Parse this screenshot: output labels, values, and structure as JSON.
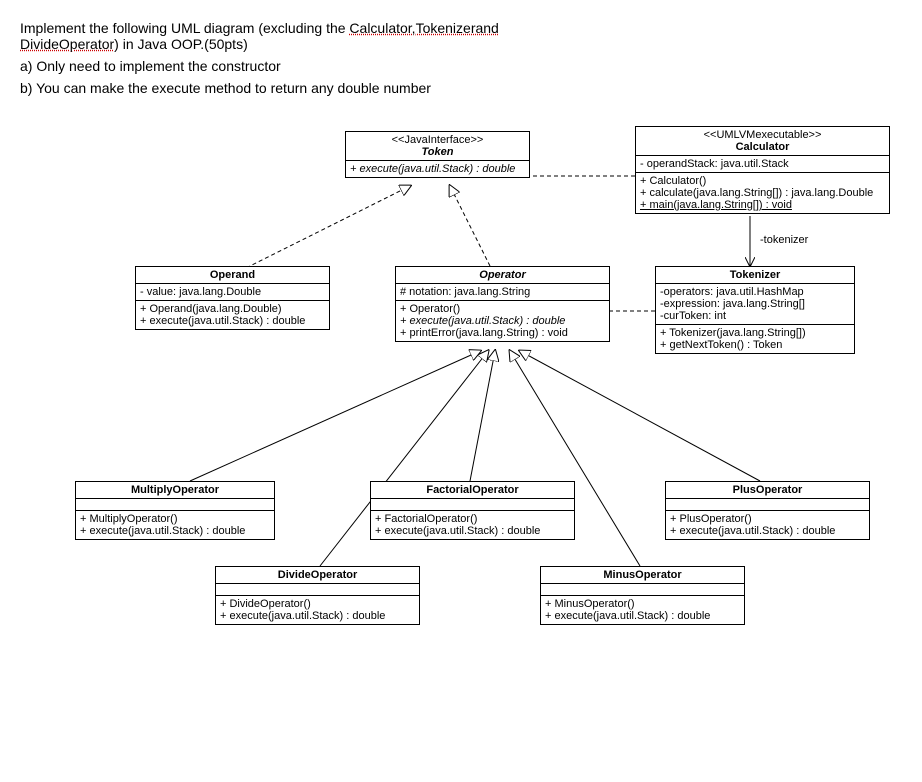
{
  "instructions": {
    "line1a": "Implement the following UML diagram (excluding the ",
    "line1b": "Calculator,Tokenizerand",
    "line2a": "DivideOperator",
    "line2b": ") in Java OOP.(50pts)",
    "lineA": "a) Only need to implement the constructor",
    "lineB": "b) You can make the execute method to return any double number"
  },
  "token": {
    "stereo": "<<JavaInterface>>",
    "name": "Token",
    "methods": "+ execute(java.util.Stack) : double"
  },
  "calculator": {
    "stereo": "<<UMLVMexecutable>>",
    "name": "Calculator",
    "attrs": "- operandStack: java.util.Stack",
    "m1": "+ Calculator()",
    "m2": "+ calculate(java.lang.String[]) : java.lang.Double",
    "m3": "+ main(java.lang.String[]) : void"
  },
  "operand": {
    "name": "Operand",
    "attrs": "- value: java.lang.Double",
    "m1": "+ Operand(java.lang.Double)",
    "m2": "+ execute(java.util.Stack) : double"
  },
  "operator": {
    "name": "Operator",
    "attrs": "# notation: java.lang.String",
    "m1": "+ Operator()",
    "m2": "+ execute(java.util.Stack) : double",
    "m3": "+ printError(java.lang.String) : void"
  },
  "tokenizer": {
    "name": "Tokenizer",
    "a1": "-operators: java.util.HashMap",
    "a2": "-expression: java.lang.String[]",
    "a3": "-curToken: int",
    "m1": "+ Tokenizer(java.lang.String[])",
    "m2": "+ getNextToken() : Token",
    "assoc": "-tokenizer"
  },
  "multiply": {
    "name": "MultiplyOperator",
    "m1": "+ MultiplyOperator()",
    "m2": "+ execute(java.util.Stack) : double"
  },
  "factorial": {
    "name": "FactorialOperator",
    "m1": "+ FactorialOperator()",
    "m2": "+ execute(java.util.Stack) : double"
  },
  "plus": {
    "name": "PlusOperator",
    "m1": "+ PlusOperator()",
    "m2": "+ execute(java.util.Stack) : double"
  },
  "divide": {
    "name": "DivideOperator",
    "m1": "+ DivideOperator()",
    "m2": "+ execute(java.util.Stack) : double"
  },
  "minus": {
    "name": "MinusOperator",
    "m1": "+ MinusOperator()",
    "m2": "+ execute(java.util.Stack) : double"
  }
}
